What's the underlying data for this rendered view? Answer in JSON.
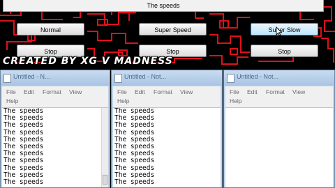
{
  "app": {
    "title": "The speeds",
    "buttons": {
      "normal": "Normal",
      "super_speed": "Super Speed",
      "super_slow": "Super Slow",
      "stop_1": "Stop",
      "stop_2": "Stop",
      "stop_3": "Stop"
    },
    "credit": "CREATED BY XG V MADNESS"
  },
  "windows": [
    {
      "title": "Untitled - N...",
      "menu": [
        "File",
        "Edit",
        "Format",
        "View",
        "Help"
      ]
    },
    {
      "title": "Untitled - Not...",
      "menu": [
        "File",
        "Edit",
        "Format",
        "View",
        "Help"
      ]
    },
    {
      "title": "Untitled - Not...",
      "menu": [
        "File",
        "Edit",
        "Format",
        "View",
        "Help"
      ]
    }
  ],
  "notepad_text_line": "The speeds",
  "colors": {
    "circuit": "#e0101a",
    "background": "#000000",
    "caption": "#bcd4ec"
  }
}
